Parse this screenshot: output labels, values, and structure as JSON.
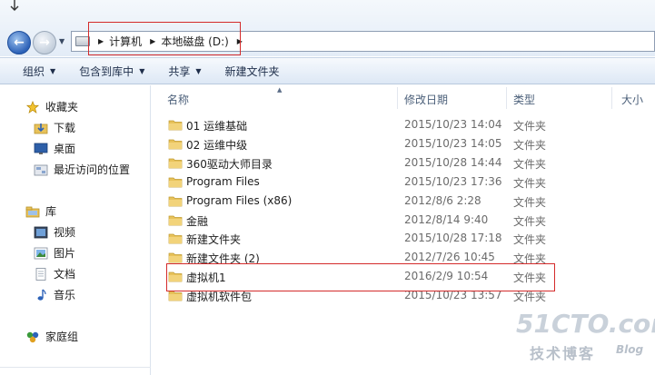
{
  "address": {
    "breadcrumbs": [
      "计算机",
      "本地磁盘 (D:)"
    ]
  },
  "toolbar": {
    "organize": "组织",
    "include_in_library": "包含到库中",
    "share": "共享",
    "new_folder": "新建文件夹"
  },
  "nav": {
    "favorites": "收藏夹",
    "downloads": "下载",
    "desktop": "桌面",
    "recent": "最近访问的位置",
    "libraries": "库",
    "videos": "视频",
    "pictures": "图片",
    "documents": "文档",
    "music": "音乐",
    "homegroup": "家庭组"
  },
  "columns": {
    "name": "名称",
    "date_modified": "修改日期",
    "type": "类型",
    "size": "大小"
  },
  "files": [
    {
      "name": "01 运维基础",
      "date": "2015/10/23 14:04",
      "type": "文件夹"
    },
    {
      "name": "02 运维中级",
      "date": "2015/10/23 14:05",
      "type": "文件夹"
    },
    {
      "name": "360驱动大师目录",
      "date": "2015/10/28 14:44",
      "type": "文件夹"
    },
    {
      "name": "Program Files",
      "date": "2015/10/23 17:36",
      "type": "文件夹"
    },
    {
      "name": "Program Files (x86)",
      "date": "2012/8/6 2:28",
      "type": "文件夹"
    },
    {
      "name": "金融",
      "date": "2012/8/14 9:40",
      "type": "文件夹"
    },
    {
      "name": "新建文件夹",
      "date": "2015/10/28 17:18",
      "type": "文件夹"
    },
    {
      "name": "新建文件夹 (2)",
      "date": "2012/7/26 10:45",
      "type": "文件夹"
    },
    {
      "name": "虚拟机1",
      "date": "2016/2/9 10:54",
      "type": "文件夹"
    },
    {
      "name": "虚拟机软件包",
      "date": "2015/10/23 13:57",
      "type": "文件夹"
    }
  ],
  "watermark": {
    "site": "51CTO.com",
    "subtitle": "技术博客",
    "blog": "Blog"
  },
  "colors": {
    "highlight": "#d42b2b",
    "folder": "#e8c25a",
    "toolbar_text": "#1e2e4a"
  }
}
